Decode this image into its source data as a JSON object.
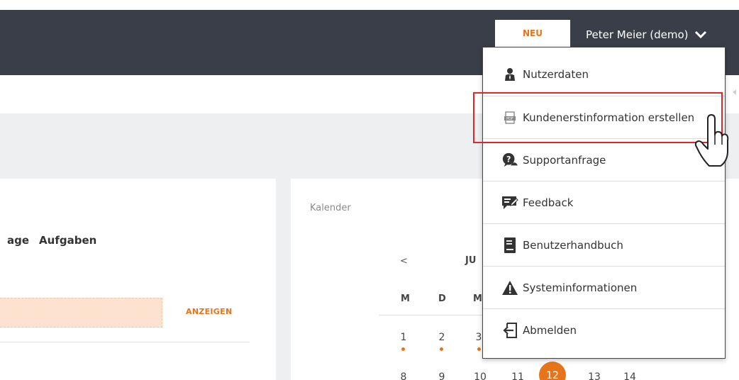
{
  "header": {
    "badge": "NEU",
    "user_name": "Peter Meier (demo)"
  },
  "tabs": [
    "age",
    "Aufgaben"
  ],
  "left_panel": {
    "show_label": "ANZEIGEN"
  },
  "calendar": {
    "title": "Kalender",
    "prev": "<",
    "month_partial": "JU",
    "weekdays": [
      "M",
      "D",
      "M"
    ],
    "row1": [
      "1",
      "2",
      "3"
    ],
    "row2": [
      "8",
      "9",
      "10",
      "11",
      "12",
      "13",
      "14"
    ],
    "today": "12"
  },
  "user_menu": {
    "items": [
      {
        "label": "Nutzerdaten",
        "icon": "user-icon"
      },
      {
        "label": "Kundenerstinformation erstellen",
        "icon": "pdf-icon"
      },
      {
        "label": "Supportanfrage",
        "icon": "support-icon"
      },
      {
        "label": "Feedback",
        "icon": "feedback-icon"
      },
      {
        "label": "Benutzerhandbuch",
        "icon": "book-icon"
      },
      {
        "label": "Systeminformationen",
        "icon": "warning-icon"
      },
      {
        "label": "Abmelden",
        "icon": "logout-icon"
      }
    ]
  },
  "colors": {
    "topbar": "#3a3e48",
    "accent": "#e8741a",
    "highlight": "#e0262b"
  }
}
